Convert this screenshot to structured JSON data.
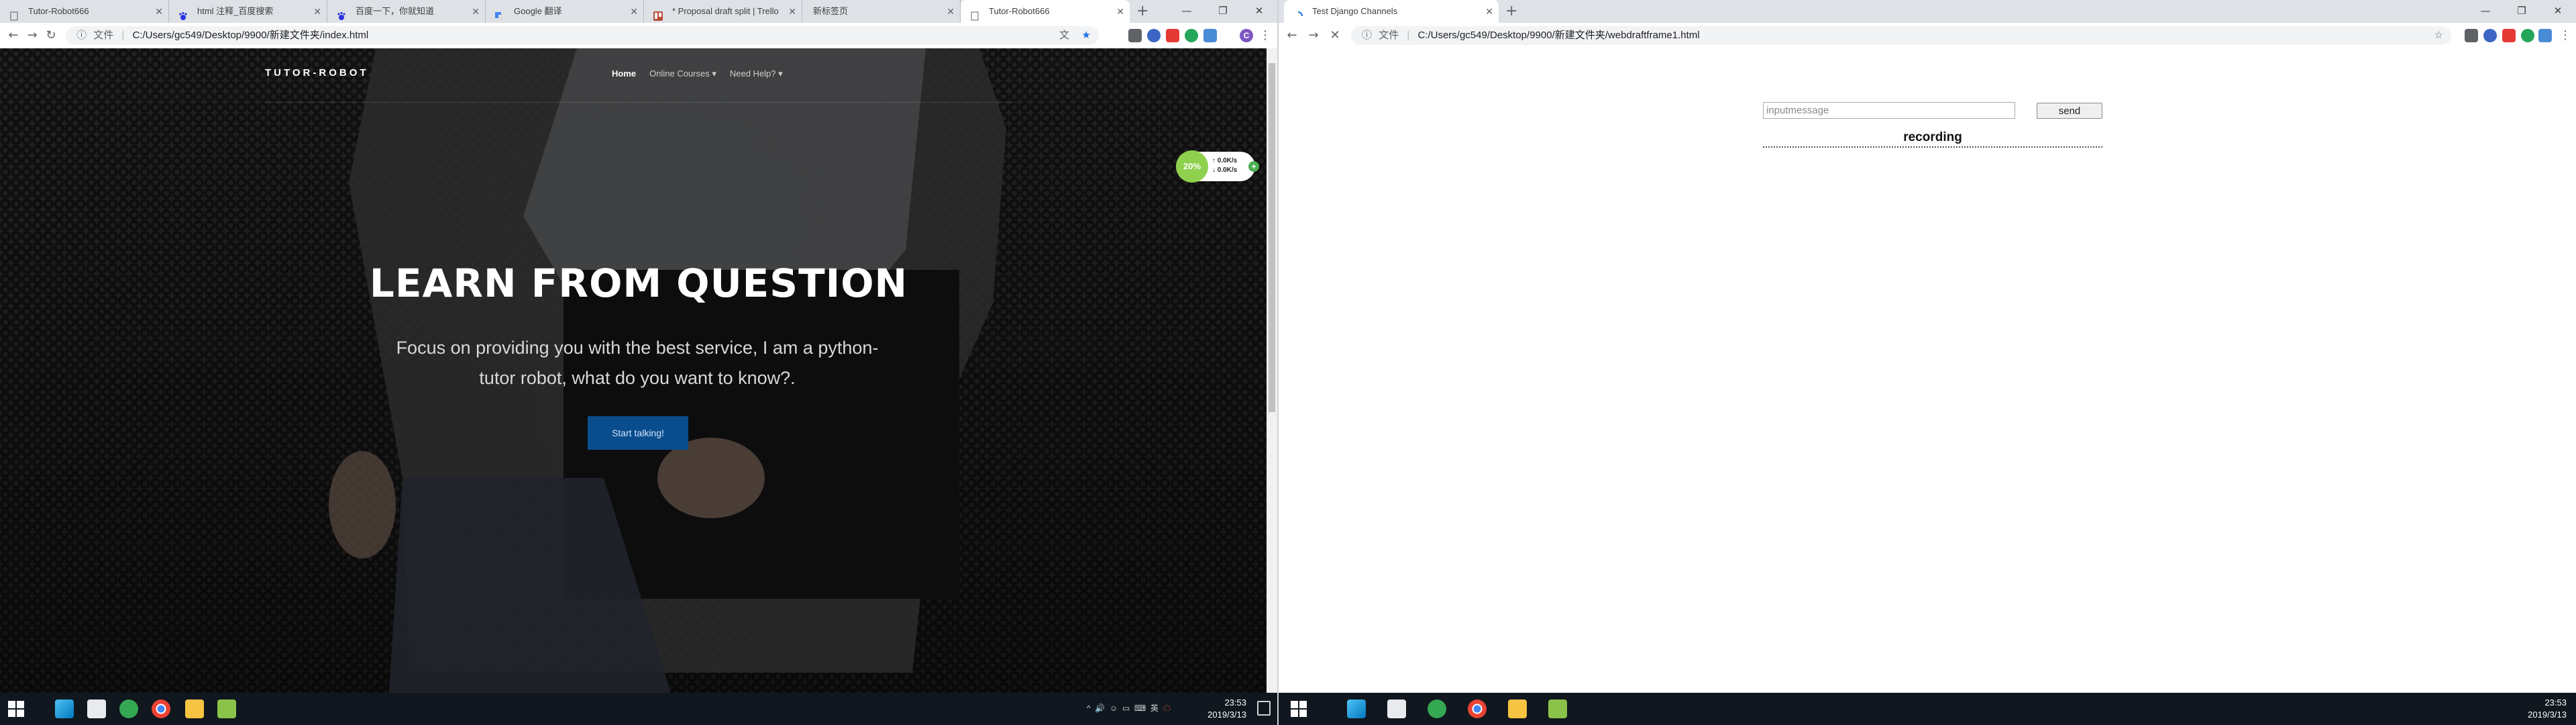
{
  "left_window": {
    "tabs": [
      {
        "title": "Tutor-Robot666",
        "icon": "page-icon",
        "active": false
      },
      {
        "title": "html 注释_百度搜索",
        "icon": "baidu-paw-icon",
        "active": false
      },
      {
        "title": "百度一下，你就知道",
        "icon": "baidu-paw-icon",
        "active": false
      },
      {
        "title": "Google 翻译",
        "icon": "google-translate-icon",
        "active": false
      },
      {
        "title": "* Proposal draft split | Trello",
        "icon": "trello-icon",
        "active": false
      },
      {
        "title": "新标签页",
        "icon": "",
        "active": false
      },
      {
        "title": "Tutor-Robot666",
        "icon": "page-icon",
        "active": true
      }
    ],
    "address": {
      "scheme_label": "文件",
      "url": "C:/Users/gc549/Desktop/9900/新建文件夹/index.html"
    },
    "page": {
      "brand": "TUTOR-ROBOT",
      "menu": [
        {
          "label": "Home",
          "active": true
        },
        {
          "label": "Online Courses ▾",
          "active": false
        },
        {
          "label": "Need Help? ▾",
          "active": false
        }
      ],
      "headline": "LEARN FROM QUESTION",
      "subheadline": "Focus on providing you with the best service, I am a python-tutor robot, what do you want to know?.",
      "cta_label": "Start talking!",
      "net_widget": {
        "percent": "20%",
        "up": "0.0K/s",
        "down": "0.0K/s"
      }
    },
    "taskbar": {
      "tray_icons": [
        "^",
        "🔊",
        "☺",
        "▭",
        "⌨",
        "英",
        "☁"
      ],
      "time": "23:53",
      "date": "2019/3/13"
    }
  },
  "right_window": {
    "tabs": [
      {
        "title": "Test Django Channels",
        "icon": "loading-icon",
        "active": true
      }
    ],
    "address": {
      "scheme_label": "文件",
      "url": "C:/Users/gc549/Desktop/9900/新建文件夹/webdraftframe1.html"
    },
    "page": {
      "input_placeholder": "inputmessage",
      "send_label": "send",
      "recording_label": "recording"
    },
    "taskbar": {
      "time": "23:53",
      "date": "2019/3/13"
    }
  },
  "colors": {
    "chrome_tabstrip": "#dee1e6",
    "taskbar": "#10171f",
    "cta_blue": "#0a4d8c",
    "widget_green": "#8fd14f"
  }
}
